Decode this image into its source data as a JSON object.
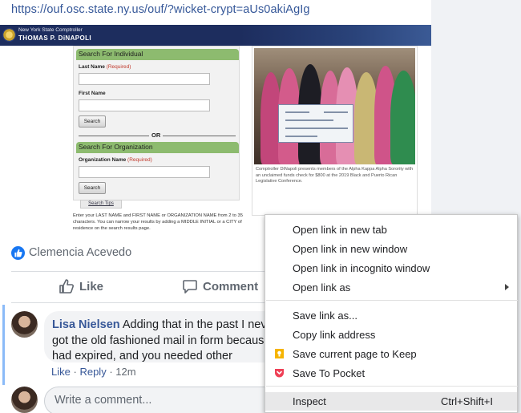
{
  "post": {
    "link_url": "https://ouf.osc.state.ny.us/ouf/?wicket-crypt=aUs0akiAgIg",
    "preview": {
      "banner_line1": "New York State Comptroller",
      "banner_line2": "THOMAS P. DiNAPOLI",
      "individual_header": "Search For Individual",
      "last_name_label": "Last Name",
      "first_name_label": "First Name",
      "required": "(Required)",
      "search_button": "Search",
      "or_text": "OR",
      "organization_header": "Search For Organization",
      "org_name_label": "Organization Name",
      "search_tips": "Search Tips",
      "instructions": "Enter your LAST NAME and FIRST NAME or ORGANIZATION NAME from 2 to 35 characters. You can narrow your results by adding a MIDDLE INITIAL or a CITY of residence on the search results page.",
      "photo_caption": "Comptroller DiNapoli presents members of the Alpha Kappa Alpha Sorority with an unclaimed funds check for $800 at the 2019 Black and Puerto Rican Legislative Conference."
    },
    "reactor_name": "Clemencia Acevedo",
    "actions": {
      "like": "Like",
      "comment": "Comment"
    }
  },
  "comment": {
    "author": "Lisa Nielsen",
    "text": "Adding that in the past I never got the old fashioned mail in form because it had expired, and you needed other documentation",
    "like": "Like",
    "reply": "Reply",
    "time": "12m",
    "separator": "·"
  },
  "write_comment": {
    "placeholder": "Write a comment..."
  },
  "context_menu": {
    "items": [
      {
        "label": "Open link in new tab"
      },
      {
        "label": "Open link in new window"
      },
      {
        "label": "Open link in incognito window"
      },
      {
        "label": "Open link as"
      },
      {
        "label": "Save link as..."
      },
      {
        "label": "Copy link address"
      },
      {
        "label": "Save current page to Keep",
        "icon": "keep-icon"
      },
      {
        "label": "Save To Pocket",
        "icon": "pocket-icon"
      },
      {
        "label": "Inspect",
        "shortcut": "Ctrl+Shift+I"
      }
    ]
  },
  "colors": {
    "facebook_blue": "#1877f2",
    "link_blue": "#385898",
    "banner_navy": "#1d2d5e",
    "section_green": "#8dbb6f",
    "keep_yellow": "#f6b400",
    "pocket_red": "#ef4056"
  }
}
